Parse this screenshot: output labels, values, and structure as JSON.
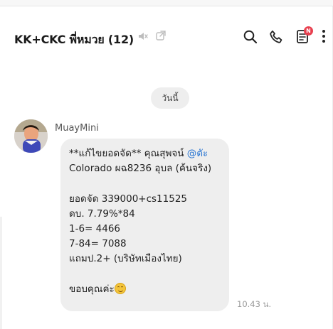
{
  "chat": {
    "title": "KK+CKC พี่หมวย (12)",
    "notification_badge": "N",
    "date_separator": "วันนี้"
  },
  "message": {
    "sender": "MuayMini",
    "line_1_prefix": "**แก้ไขยอดจัด** คุณสุพจน์ ",
    "mention": "@ตัะ",
    "line_2": "Colorado ผฉ8236 อุบล (ค้นจริง)",
    "line_3": "ยอดจัด 339000+cs11525",
    "line_4": "ดบ. 7.79%*84",
    "line_5": "1-6= 4466",
    "line_6": "7-84= 7088",
    "line_7": "แถมป.2+ (บริษัทเมืองไทย)",
    "line_8": "ขอบคุณค่ะ",
    "time": "10.43 น."
  },
  "icons": {
    "mute": "speaker-muted-icon",
    "share": "external-link-icon",
    "search": "search-icon",
    "call": "phone-icon",
    "notes": "notes-icon",
    "menu": "more-vertical-icon",
    "emoji": "smiling-face-emoji"
  },
  "colors": {
    "badge": "#e8404f",
    "mention": "#2774d1",
    "bubble": "#eeeeee"
  }
}
